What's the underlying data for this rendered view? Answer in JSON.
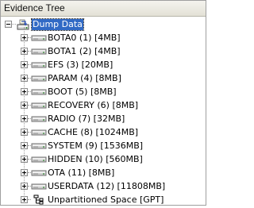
{
  "panel": {
    "title": "Evidence Tree"
  },
  "tree": {
    "root": {
      "label": "Dump Data",
      "icon": "disk-image-icon"
    },
    "children": [
      {
        "label": "BOTA0 (1) [4MB]",
        "icon": "partition-icon"
      },
      {
        "label": "BOTA1 (2) [4MB]",
        "icon": "partition-icon"
      },
      {
        "label": "EFS (3) [20MB]",
        "icon": "partition-icon"
      },
      {
        "label": "PARAM (4) [8MB]",
        "icon": "partition-icon"
      },
      {
        "label": "BOOT (5) [8MB]",
        "icon": "partition-icon"
      },
      {
        "label": "RECOVERY (6) [8MB]",
        "icon": "partition-icon"
      },
      {
        "label": "RADIO (7) [32MB]",
        "icon": "partition-icon"
      },
      {
        "label": "CACHE (8) [1024MB]",
        "icon": "partition-icon"
      },
      {
        "label": "SYSTEM (9) [1536MB]",
        "icon": "partition-icon"
      },
      {
        "label": "HIDDEN (10) [560MB]",
        "icon": "partition-icon"
      },
      {
        "label": "OTA (11) [8MB]",
        "icon": "partition-icon"
      },
      {
        "label": "USERDATA (12) [11808MB]",
        "icon": "partition-icon"
      },
      {
        "label": "Unpartitioned Space [GPT]",
        "icon": "unpartitioned-space-icon"
      }
    ]
  }
}
